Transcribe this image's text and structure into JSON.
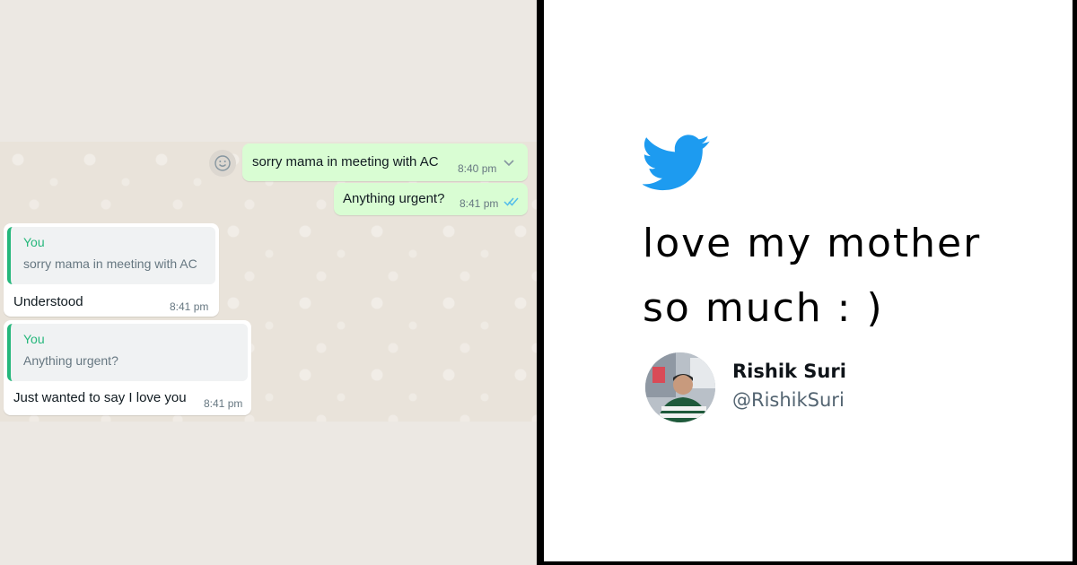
{
  "chat": {
    "outgoing": [
      {
        "text": "sorry mama in meeting with AC",
        "time": "8:40 pm"
      },
      {
        "text": "Anything urgent?",
        "time": "8:41 pm"
      }
    ],
    "incoming": [
      {
        "quote_author": "You",
        "quote_text": "sorry mama in meeting with AC",
        "text": "Understood",
        "time": "8:41 pm"
      },
      {
        "quote_author": "You",
        "quote_text": "Anything urgent?",
        "text": "Just wanted to say I love you",
        "time": "8:41 pm"
      }
    ],
    "icons": {
      "reaction": "smiley-icon",
      "menu": "chevron-down-icon",
      "read": "double-check-icon"
    },
    "colors": {
      "outgoing_bubble": "#d9fdd3",
      "incoming_bubble": "#ffffff",
      "quote_accent": "#25b77b",
      "read_ticks": "#53bdeb"
    }
  },
  "tweet": {
    "lines": [
      "love my mother",
      "so much : )"
    ],
    "author_name": "Rishik Suri",
    "author_handle": "@RishikSuri",
    "icons": {
      "logo": "twitter-bird-icon"
    },
    "colors": {
      "brand": "#1d9bf0"
    }
  }
}
